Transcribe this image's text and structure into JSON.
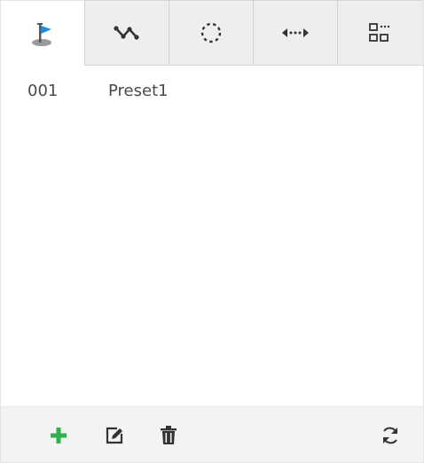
{
  "tabs": [
    {
      "icon": "preset-flag-icon",
      "active": true
    },
    {
      "icon": "tour-path-icon",
      "active": false
    },
    {
      "icon": "pattern-circle-icon",
      "active": false
    },
    {
      "icon": "scan-horizontal-icon",
      "active": false
    },
    {
      "icon": "more-functions-icon",
      "active": false
    }
  ],
  "presets": [
    {
      "number": "001",
      "name": "Preset1"
    }
  ],
  "toolbar": {
    "add_icon": "add-icon",
    "edit_icon": "edit-icon",
    "delete_icon": "delete-icon",
    "refresh_icon": "refresh-icon"
  },
  "colors": {
    "flag_blue": "#1e8de0",
    "add_green": "#2db34a",
    "icon_dark": "#333333",
    "text": "#4a4a4a"
  }
}
